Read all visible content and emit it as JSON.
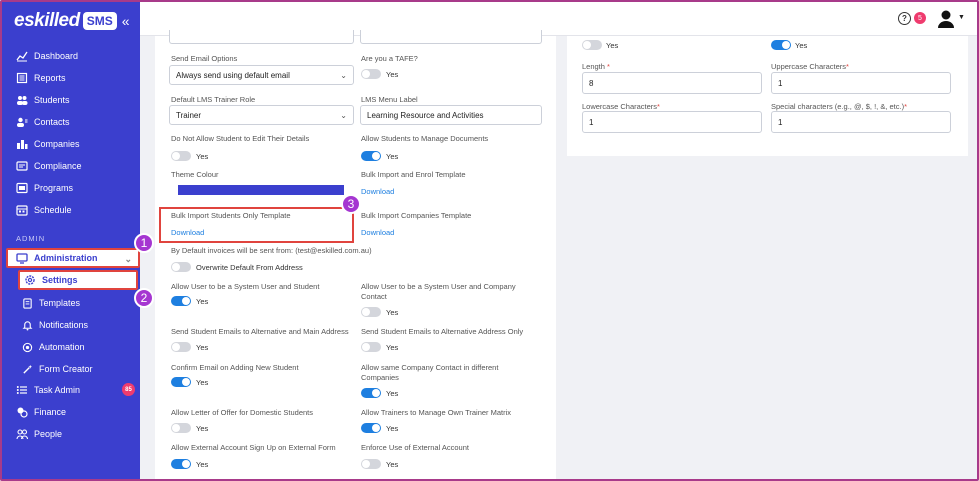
{
  "brand": {
    "name": "eskilled",
    "badge": "SMS",
    "collapse": "«"
  },
  "sidebar": {
    "items": [
      {
        "label": "Dashboard",
        "icon": "chart-line-icon"
      },
      {
        "label": "Reports",
        "icon": "reports-icon"
      },
      {
        "label": "Students",
        "icon": "students-icon"
      },
      {
        "label": "Contacts",
        "icon": "contacts-icon"
      },
      {
        "label": "Companies",
        "icon": "companies-icon"
      },
      {
        "label": "Compliance",
        "icon": "compliance-icon"
      },
      {
        "label": "Programs",
        "icon": "programs-icon"
      },
      {
        "label": "Schedule",
        "icon": "schedule-icon"
      }
    ],
    "section": "ADMIN",
    "admin": "Administration",
    "settings": "Settings",
    "sub": [
      {
        "label": "Templates"
      },
      {
        "label": "Notifications"
      },
      {
        "label": "Automation"
      },
      {
        "label": "Form Creator"
      }
    ],
    "more": [
      {
        "label": "Task Admin"
      },
      {
        "label": "Finance"
      },
      {
        "label": "People"
      }
    ],
    "task_badge": "85"
  },
  "callouts": [
    "1",
    "2",
    "3"
  ],
  "topbar": {
    "help": "?",
    "help_badge": "5"
  },
  "left": {
    "send_email_label": "Send Email Options",
    "send_email_value": "Always send using default email",
    "tafe_label": "Are you a TAFE?",
    "trainer_role_label": "Default LMS Trainer Role",
    "trainer_role_value": "Trainer",
    "lms_menu_label": "LMS Menu Label",
    "lms_menu_value": "Learning Resource and Activities",
    "no_edit_label": "Do Not Allow Student to Edit Their Details",
    "manage_docs_label": "Allow Students to Manage Documents",
    "theme_label": "Theme Colour",
    "theme_color": "#3b3fce",
    "bulk_enrol_label": "Bulk Import and Enrol Template",
    "bulk_students_label": "Bulk Import Students Only Template",
    "bulk_companies_label": "Bulk Import Companies Template",
    "download": "Download",
    "invoice_label": "By Default invoices will be sent from: (test@eskilled.com.au)",
    "overwrite_label": "Overwrite Default From Address",
    "sys_student_label": "Allow User to be a System User and Student",
    "sys_company_label": "Allow User to be a System User and Company Contact",
    "alt_main_label": "Send Student Emails to Alternative and Main Address",
    "alt_only_label": "Send Student Emails to Alternative Address Only",
    "confirm_email_label": "Confirm Email on Adding New Student",
    "same_contact_label": "Allow same Company Contact in different Companies",
    "letter_offer_label": "Allow Letter of Offer for Domestic Students",
    "trainer_matrix_label": "Allow Trainers to Manage Own Trainer Matrix",
    "ext_signup_label": "Allow External Account Sign Up on External Form",
    "enforce_ext_label": "Enforce Use of External Account",
    "yes": "Yes"
  },
  "right": {
    "length_label": "Length",
    "length_value": "8",
    "upper_label": "Uppercase Characters",
    "upper_value": "1",
    "lower_label": "Lowercase Characters",
    "lower_value": "1",
    "special_label": "Special characters (e.g., @, $, !, &, etc.)",
    "special_value": "1",
    "req": "*"
  }
}
